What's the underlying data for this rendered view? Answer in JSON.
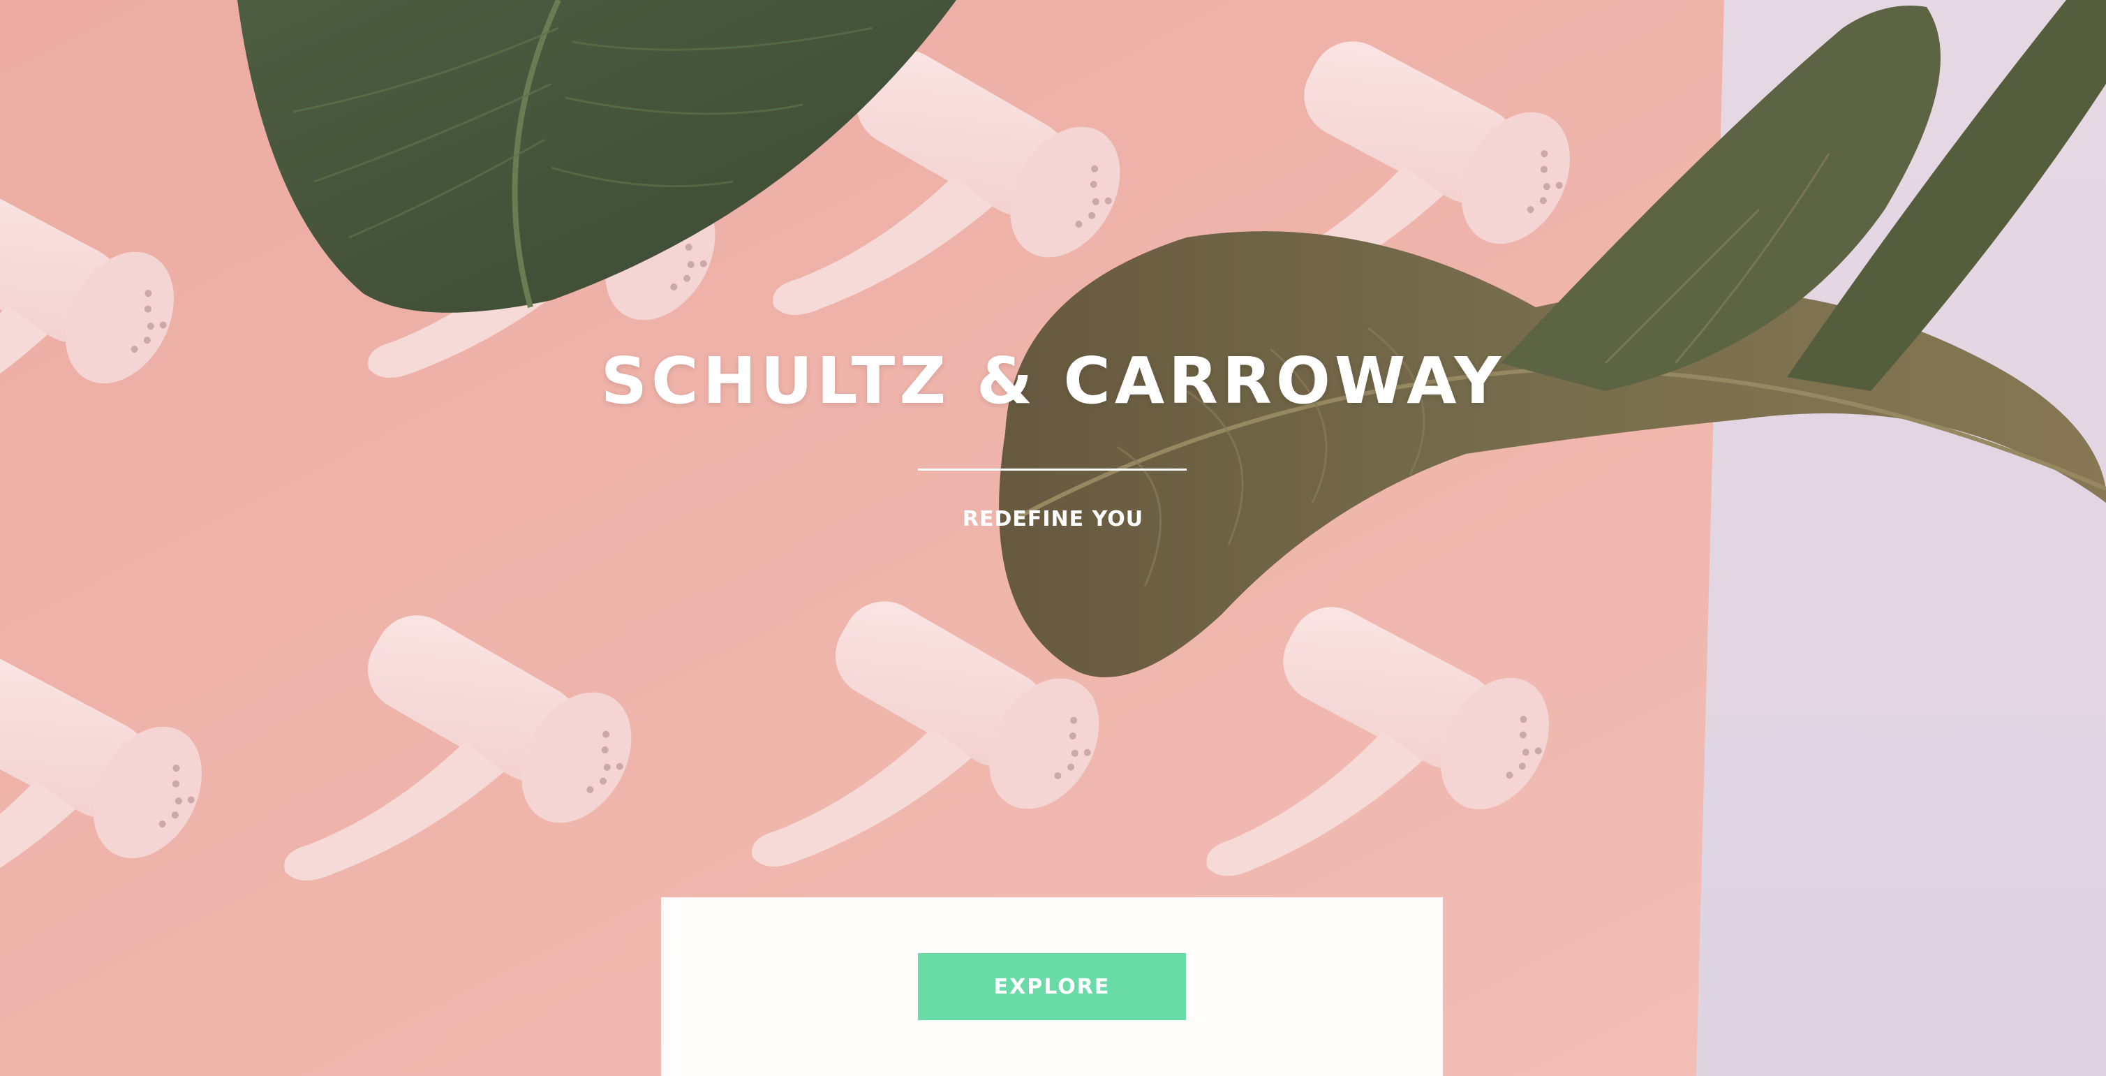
{
  "hero": {
    "title": "SCHULTZ & CARROWAY",
    "tagline": "REDEFINE YOU",
    "background_image": "pink-wall-with-hair-dryers-and-leaves"
  },
  "cta": {
    "explore_label": "EXPLORE"
  },
  "colors": {
    "accent": "#69dba6",
    "background_pink": "#eab0a6",
    "panel": "#ffffff",
    "text": "#ffffff"
  }
}
